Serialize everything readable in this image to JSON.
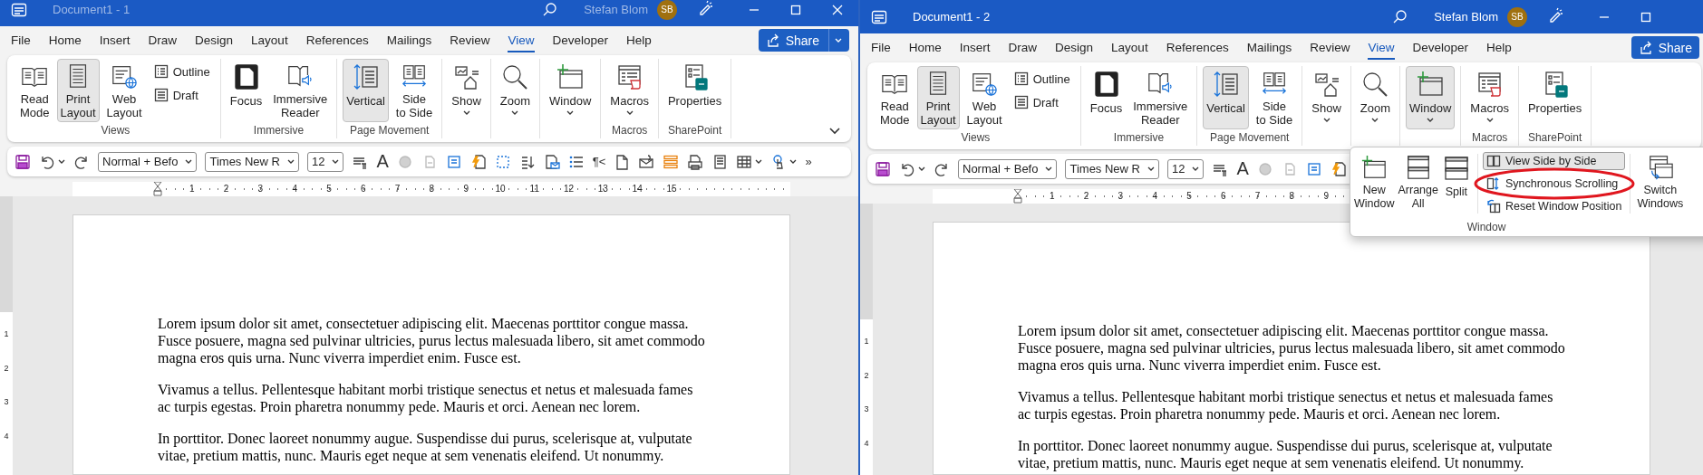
{
  "windows": [
    {
      "title": "Document1 - 1",
      "active": false,
      "user": "Stefan Blom",
      "avatar": "SB",
      "caption_buttons": [
        {
          "kind": "minimize"
        },
        {
          "kind": "maximize"
        },
        {
          "kind": "close"
        }
      ],
      "tabs": [
        {
          "label": "File",
          "selected": false
        },
        {
          "label": "Home",
          "selected": false
        },
        {
          "label": "Insert",
          "selected": false
        },
        {
          "label": "Draw",
          "selected": false
        },
        {
          "label": "Design",
          "selected": false
        },
        {
          "label": "Layout",
          "selected": false
        },
        {
          "label": "References",
          "selected": false
        },
        {
          "label": "Mailings",
          "selected": false
        },
        {
          "label": "Review",
          "selected": false
        },
        {
          "label": "View",
          "selected": true
        },
        {
          "label": "Developer",
          "selected": false
        },
        {
          "label": "Help",
          "selected": false
        }
      ],
      "share": {
        "label": "Share",
        "dropdown": true
      },
      "ribbon": {
        "show_collapse": true,
        "groups": [
          {
            "label": "Views",
            "items": [
              {
                "kind": "read-mode",
                "stacked": false,
                "label": "Read\nMode",
                "selected": false
              },
              {
                "kind": "print-layout",
                "stacked": false,
                "label": "Print\nLayout",
                "selected": true
              },
              {
                "kind": "web-layout",
                "stacked": false,
                "label": "Web\nLayout",
                "selected": false
              },
              {
                "kind": "outline",
                "stacked": true,
                "label": "Outline",
                "selected": false
              },
              {
                "kind": "draft",
                "stacked": true,
                "label": "Draft",
                "selected": false
              }
            ]
          },
          {
            "label": "Immersive",
            "items": [
              {
                "kind": "focus",
                "stacked": false,
                "label": "Focus",
                "selected": false
              },
              {
                "kind": "immersive-reader",
                "stacked": false,
                "label": "Immersive\nReader",
                "selected": false
              }
            ]
          },
          {
            "label": "Page Movement",
            "items": [
              {
                "kind": "vertical",
                "stacked": false,
                "label": "Vertical",
                "selected": true
              },
              {
                "kind": "side-to-side",
                "stacked": false,
                "label": "Side\nto Side",
                "selected": false
              }
            ]
          },
          {
            "items": [
              {
                "kind": "show",
                "stacked": false,
                "label": "Show",
                "selected": false,
                "dropdown": true
              }
            ]
          },
          {
            "items": [
              {
                "kind": "zoom",
                "stacked": false,
                "label": "Zoom",
                "selected": false,
                "dropdown": true
              }
            ]
          },
          {
            "items": [
              {
                "kind": "window",
                "stacked": false,
                "label": "Window",
                "selected": false,
                "dropdown": true
              }
            ]
          },
          {
            "label": "Macros",
            "items": [
              {
                "kind": "macros",
                "stacked": false,
                "label": "Macros",
                "selected": false,
                "dropdown": true
              }
            ]
          },
          {
            "label": "SharePoint",
            "items": [
              {
                "kind": "properties",
                "stacked": false,
                "label": "Properties",
                "selected": false
              }
            ]
          }
        ]
      },
      "qat": [
        {
          "kind": "save"
        },
        {
          "kind": "undo",
          "dropdown": true
        },
        {
          "kind": "redo"
        },
        {
          "kind": "combo",
          "value": "Normal + Befo"
        },
        {
          "kind": "combo",
          "value": "Times New R"
        },
        {
          "kind": "combo",
          "value": "12"
        },
        {
          "kind": "paragraph-lines"
        },
        {
          "kind": "glyph",
          "text": "A"
        },
        {
          "kind": "circle"
        },
        {
          "kind": "faint-page"
        },
        {
          "kind": "text-box"
        },
        {
          "kind": "lightning-page"
        },
        {
          "kind": "dotted-selection"
        },
        {
          "kind": "sort"
        },
        {
          "kind": "mail-page"
        },
        {
          "kind": "bullet-list"
        },
        {
          "kind": "glyph",
          "text": "¶<"
        },
        {
          "kind": "page"
        },
        {
          "kind": "envelope-clip"
        },
        {
          "kind": "stripes"
        },
        {
          "kind": "print-page"
        },
        {
          "kind": "document"
        },
        {
          "kind": "table",
          "dropdown": true
        },
        {
          "kind": "touch",
          "dropdown": true
        },
        {
          "kind": "glyph",
          "text": "»"
        }
      ],
      "ruler": {
        "numbers": [
          "1",
          "2",
          "3",
          "4",
          "5",
          "6",
          "7",
          "8",
          "9",
          "10",
          "11",
          "12",
          "13",
          "14",
          "15"
        ]
      },
      "vertical_ruler": {
        "numbers": [
          "1",
          "2",
          "3",
          "4"
        ]
      },
      "document": {
        "paragraphs": [
          "Lorem ipsum dolor sit amet, consectetuer adipiscing elit. Maecenas porttitor congue massa.\nFusce posuere, magna sed pulvinar ultricies, purus lectus malesuada libero, sit amet commodo\nmagna eros quis urna. Nunc viverra imperdiet enim. Fusce est.",
          "Vivamus a tellus. Pellentesque habitant morbi tristique senectus et netus et malesuada fames\nac turpis egestas. Proin pharetra nonummy pede. Mauris et orci. Aenean nec lorem.",
          "In porttitor. Donec laoreet nonummy augue. Suspendisse dui purus, scelerisque at, vulputate\nvitae, pretium mattis, nunc. Mauris eget neque at sem venenatis eleifend. Ut nonummy."
        ]
      }
    },
    {
      "title": "Document1 - 2",
      "active": true,
      "user": "Stefan Blom",
      "avatar": "SB",
      "caption_buttons": [
        {
          "kind": "minimize"
        },
        {
          "kind": "maximize"
        }
      ],
      "tabs": [
        {
          "label": "File",
          "selected": false
        },
        {
          "label": "Home",
          "selected": false
        },
        {
          "label": "Insert",
          "selected": false
        },
        {
          "label": "Draw",
          "selected": false
        },
        {
          "label": "Design",
          "selected": false
        },
        {
          "label": "Layout",
          "selected": false
        },
        {
          "label": "References",
          "selected": false
        },
        {
          "label": "Mailings",
          "selected": false
        },
        {
          "label": "Review",
          "selected": false
        },
        {
          "label": "View",
          "selected": true
        },
        {
          "label": "Developer",
          "selected": false
        },
        {
          "label": "Help",
          "selected": false
        }
      ],
      "share": {
        "label": "Share"
      },
      "ribbon": {
        "groups": [
          {
            "label": "Views",
            "items": [
              {
                "kind": "read-mode",
                "stacked": false,
                "label": "Read\nMode",
                "selected": false
              },
              {
                "kind": "print-layout",
                "stacked": false,
                "label": "Print\nLayout",
                "selected": true
              },
              {
                "kind": "web-layout",
                "stacked": false,
                "label": "Web\nLayout",
                "selected": false
              },
              {
                "kind": "outline",
                "stacked": true,
                "label": "Outline",
                "selected": false
              },
              {
                "kind": "draft",
                "stacked": true,
                "label": "Draft",
                "selected": false
              }
            ]
          },
          {
            "label": "Immersive",
            "items": [
              {
                "kind": "focus",
                "stacked": false,
                "label": "Focus",
                "selected": false
              },
              {
                "kind": "immersive-reader",
                "stacked": false,
                "label": "Immersive\nReader",
                "selected": false
              }
            ]
          },
          {
            "label": "Page Movement",
            "items": [
              {
                "kind": "vertical",
                "stacked": false,
                "label": "Vertical",
                "selected": true
              },
              {
                "kind": "side-to-side",
                "stacked": false,
                "label": "Side\nto Side",
                "selected": false
              }
            ]
          },
          {
            "items": [
              {
                "kind": "show",
                "stacked": false,
                "label": "Show",
                "selected": false,
                "dropdown": true
              }
            ]
          },
          {
            "items": [
              {
                "kind": "zoom",
                "stacked": false,
                "label": "Zoom",
                "selected": false,
                "dropdown": true
              }
            ]
          },
          {
            "items": [
              {
                "kind": "window",
                "stacked": false,
                "label": "Window",
                "selected": true,
                "dropdown": true
              }
            ]
          },
          {
            "label": "Macros",
            "items": [
              {
                "kind": "macros",
                "stacked": false,
                "label": "Macros",
                "selected": false,
                "dropdown": true
              }
            ]
          },
          {
            "label": "SharePoint",
            "items": [
              {
                "kind": "properties",
                "stacked": false,
                "label": "Properties",
                "selected": false
              }
            ]
          }
        ]
      },
      "qat": [
        {
          "kind": "save"
        },
        {
          "kind": "undo",
          "dropdown": true
        },
        {
          "kind": "redo"
        },
        {
          "kind": "combo",
          "value": "Normal + Befo"
        },
        {
          "kind": "combo",
          "value": "Times New R"
        },
        {
          "kind": "combo",
          "value": "12"
        },
        {
          "kind": "paragraph-lines"
        },
        {
          "kind": "glyph",
          "text": "A"
        },
        {
          "kind": "circle"
        },
        {
          "kind": "faint-page"
        },
        {
          "kind": "text-box"
        },
        {
          "kind": "lightning-page"
        }
      ],
      "ruler": {
        "numbers": [
          "1",
          "2",
          "3",
          "4",
          "5",
          "6",
          "7",
          "8",
          "9"
        ]
      },
      "vertical_ruler": {
        "numbers": [
          "1",
          "2",
          "3",
          "4"
        ]
      },
      "popup": {
        "label": "Window",
        "items": [
          {
            "kind": "new-window",
            "stacked": false,
            "label": "New\nWindow",
            "selected": false
          },
          {
            "kind": "arrange-all",
            "stacked": false,
            "label": "Arrange\nAll",
            "selected": false
          },
          {
            "kind": "split",
            "stacked": false,
            "label": "Split",
            "selected": false
          },
          {
            "kind": "view-side-by-side",
            "stacked": true,
            "label": "View Side by Side",
            "selected": true
          },
          {
            "kind": "synchronous-scrolling",
            "stacked": true,
            "label": "Synchronous Scrolling",
            "selected": false,
            "annotated": true
          },
          {
            "kind": "reset-window-position",
            "stacked": true,
            "label": "Reset Window Position",
            "selected": false
          },
          {
            "kind": "switch-windows",
            "stacked": false,
            "label": "Switch\nWindows",
            "selected": false
          }
        ]
      },
      "document": {
        "paragraphs": [
          "Lorem ipsum dolor sit amet, consectetuer adipiscing elit. Maecenas porttitor congue massa.\nFusce posuere, magna sed pulvinar ultricies, purus lectus malesuada libero, sit amet commodo\nmagna eros quis urna. Nunc viverra imperdiet enim. Fusce est.",
          "Vivamus a tellus. Pellentesque habitant morbi tristique senectus et netus et malesuada fames\nac turpis egestas. Proin pharetra nonummy pede. Mauris et orci. Aenean nec lorem.",
          "In porttitor. Donec laoreet nonummy augue. Suspendisse dui purus, scelerisque at, vulputate\nvitae, pretium mattis, nunc. Mauris eget neque at sem venenatis eleifend. Ut nonummy."
        ]
      }
    }
  ]
}
